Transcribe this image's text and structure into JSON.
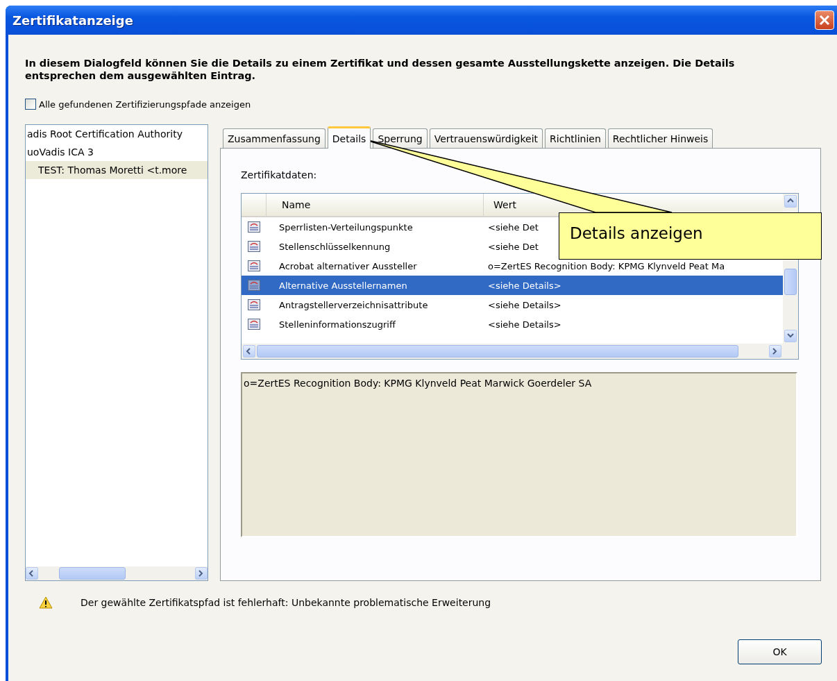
{
  "window": {
    "title": "Zertifikatanzeige"
  },
  "description": "In diesem Dialogfeld können Sie die Details zu einem Zertifikat und dessen gesamte Ausstellungskette anzeigen. Die Details entsprechen dem ausgewählten Eintrag.",
  "show_all_paths": {
    "label": "Alle gefundenen Zertifizierungspfade anzeigen",
    "checked": false
  },
  "tree": [
    {
      "label": "adis Root Certification Authority",
      "selected": false,
      "children": [
        {
          "label": "uoVadis ICA 3",
          "selected": false,
          "children": [
            {
              "label": "TEST: Thomas Moretti <t.more",
              "selected": true
            }
          ]
        }
      ]
    }
  ],
  "tabs": [
    {
      "label": "Zusammenfassung",
      "selected": false
    },
    {
      "label": "Details",
      "selected": true
    },
    {
      "label": "Sperrung",
      "selected": false
    },
    {
      "label": "Vertrauenswürdigkeit",
      "selected": false
    },
    {
      "label": "Richtlinien",
      "selected": false
    },
    {
      "label": "Rechtlicher Hinweis",
      "selected": false
    }
  ],
  "data_label": "Zertifikatdaten:",
  "table": {
    "columns": [
      "Name",
      "Wert"
    ],
    "rows": [
      {
        "name": "Sperrlisten-Verteilungspunkte",
        "value": "<siehe Det",
        "selected": false
      },
      {
        "name": "Stellenschlüsselkennung",
        "value": "<siehe Det",
        "selected": false
      },
      {
        "name": "Acrobat alternativer Aussteller",
        "value": "o=ZertES Recognition Body: KPMG Klynveld Peat Ma",
        "selected": false
      },
      {
        "name": "Alternative Ausstellernamen",
        "value": "<siehe Details>",
        "selected": true
      },
      {
        "name": "Antragstellerverzeichnisattribute",
        "value": "<siehe Details>",
        "selected": false
      },
      {
        "name": "Stelleninformationszugriff",
        "value": "<siehe Details>",
        "selected": false
      }
    ]
  },
  "detail_text": "o=ZertES Recognition Body: KPMG Klynveld Peat Marwick Goerdeler SA",
  "callout": "Details anzeigen",
  "status_message": "Der gewählte Zertifikatspfad ist fehlerhaft: Unbekannte problematische Erweiterung",
  "buttons": [
    "OK"
  ]
}
